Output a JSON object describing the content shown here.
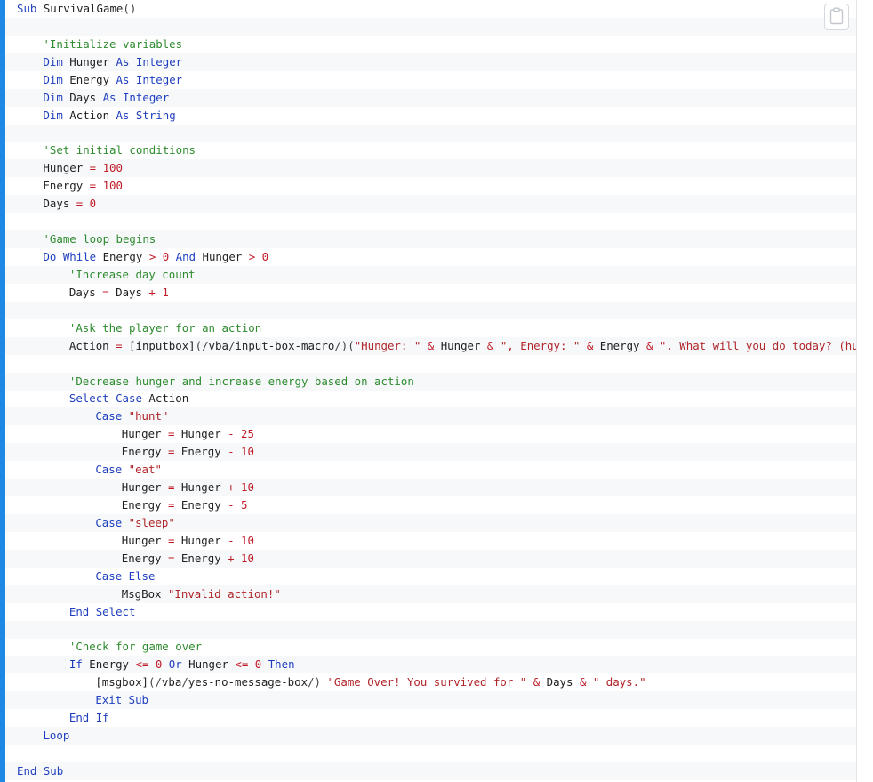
{
  "code_block": {
    "copy_button_label": "Copy",
    "lines": [
      {
        "indent": 0,
        "tokens": [
          {
            "t": "kw",
            "v": "Sub"
          },
          {
            "t": "id",
            "v": " SurvivalGame"
          },
          {
            "t": "punct",
            "v": "()"
          }
        ]
      },
      {
        "indent": 0,
        "tokens": []
      },
      {
        "indent": 4,
        "tokens": [
          {
            "t": "comment",
            "v": "'Initialize variables"
          }
        ]
      },
      {
        "indent": 4,
        "tokens": [
          {
            "t": "kw",
            "v": "Dim"
          },
          {
            "t": "id",
            "v": " Hunger "
          },
          {
            "t": "kw",
            "v": "As"
          },
          {
            "t": "type",
            "v": " Integer"
          }
        ]
      },
      {
        "indent": 4,
        "tokens": [
          {
            "t": "kw",
            "v": "Dim"
          },
          {
            "t": "id",
            "v": " Energy "
          },
          {
            "t": "kw",
            "v": "As"
          },
          {
            "t": "type",
            "v": " Integer"
          }
        ]
      },
      {
        "indent": 4,
        "tokens": [
          {
            "t": "kw",
            "v": "Dim"
          },
          {
            "t": "id",
            "v": " Days "
          },
          {
            "t": "kw",
            "v": "As"
          },
          {
            "t": "type",
            "v": " Integer"
          }
        ]
      },
      {
        "indent": 4,
        "tokens": [
          {
            "t": "kw",
            "v": "Dim"
          },
          {
            "t": "id",
            "v": " Action "
          },
          {
            "t": "kw",
            "v": "As"
          },
          {
            "t": "type",
            "v": " String"
          }
        ]
      },
      {
        "indent": 0,
        "tokens": []
      },
      {
        "indent": 4,
        "tokens": [
          {
            "t": "comment",
            "v": "'Set initial conditions"
          }
        ]
      },
      {
        "indent": 4,
        "tokens": [
          {
            "t": "id",
            "v": "Hunger "
          },
          {
            "t": "op",
            "v": "="
          },
          {
            "t": "num",
            "v": " 100"
          }
        ]
      },
      {
        "indent": 4,
        "tokens": [
          {
            "t": "id",
            "v": "Energy "
          },
          {
            "t": "op",
            "v": "="
          },
          {
            "t": "num",
            "v": " 100"
          }
        ]
      },
      {
        "indent": 4,
        "tokens": [
          {
            "t": "id",
            "v": "Days "
          },
          {
            "t": "op",
            "v": "="
          },
          {
            "t": "num",
            "v": " 0"
          }
        ]
      },
      {
        "indent": 0,
        "tokens": []
      },
      {
        "indent": 4,
        "tokens": [
          {
            "t": "comment",
            "v": "'Game loop begins"
          }
        ]
      },
      {
        "indent": 4,
        "tokens": [
          {
            "t": "kw",
            "v": "Do While"
          },
          {
            "t": "id",
            "v": " Energy "
          },
          {
            "t": "op",
            "v": ">"
          },
          {
            "t": "num",
            "v": " 0"
          },
          {
            "t": "kw",
            "v": " And"
          },
          {
            "t": "id",
            "v": " Hunger "
          },
          {
            "t": "op",
            "v": ">"
          },
          {
            "t": "num",
            "v": " 0"
          }
        ]
      },
      {
        "indent": 8,
        "tokens": [
          {
            "t": "comment",
            "v": "'Increase day count"
          }
        ]
      },
      {
        "indent": 8,
        "tokens": [
          {
            "t": "id",
            "v": "Days "
          },
          {
            "t": "op",
            "v": "="
          },
          {
            "t": "id",
            "v": " Days "
          },
          {
            "t": "op",
            "v": "+"
          },
          {
            "t": "num",
            "v": " 1"
          }
        ]
      },
      {
        "indent": 0,
        "tokens": []
      },
      {
        "indent": 8,
        "tokens": [
          {
            "t": "comment",
            "v": "'Ask the player for an action"
          }
        ]
      },
      {
        "indent": 8,
        "tokens": [
          {
            "t": "id",
            "v": "Action "
          },
          {
            "t": "op",
            "v": "="
          },
          {
            "t": "id",
            "v": " [inputbox]"
          },
          {
            "t": "punct",
            "v": "(/"
          },
          {
            "t": "id",
            "v": "vba"
          },
          {
            "t": "punct",
            "v": "/"
          },
          {
            "t": "id",
            "v": "input-box-macro"
          },
          {
            "t": "punct",
            "v": "/)("
          },
          {
            "t": "str",
            "v": "\"Hunger: \""
          },
          {
            "t": "op",
            "v": " &"
          },
          {
            "t": "id",
            "v": " Hunger "
          },
          {
            "t": "op",
            "v": "&"
          },
          {
            "t": "str",
            "v": " \", Energy: \""
          },
          {
            "t": "op",
            "v": " &"
          },
          {
            "t": "id",
            "v": " Energy "
          },
          {
            "t": "op",
            "v": "&"
          },
          {
            "t": "str",
            "v": " \". What will you do today? (hunt"
          }
        ]
      },
      {
        "indent": 0,
        "tokens": []
      },
      {
        "indent": 8,
        "tokens": [
          {
            "t": "comment",
            "v": "'Decrease hunger and increase energy based on action"
          }
        ]
      },
      {
        "indent": 8,
        "tokens": [
          {
            "t": "kw",
            "v": "Select Case"
          },
          {
            "t": "id",
            "v": " Action"
          }
        ]
      },
      {
        "indent": 12,
        "tokens": [
          {
            "t": "kw",
            "v": "Case"
          },
          {
            "t": "str",
            "v": " \"hunt\""
          }
        ]
      },
      {
        "indent": 16,
        "tokens": [
          {
            "t": "id",
            "v": "Hunger "
          },
          {
            "t": "op",
            "v": "="
          },
          {
            "t": "id",
            "v": " Hunger "
          },
          {
            "t": "op",
            "v": "-"
          },
          {
            "t": "num",
            "v": " 25"
          }
        ]
      },
      {
        "indent": 16,
        "tokens": [
          {
            "t": "id",
            "v": "Energy "
          },
          {
            "t": "op",
            "v": "="
          },
          {
            "t": "id",
            "v": " Energy "
          },
          {
            "t": "op",
            "v": "-"
          },
          {
            "t": "num",
            "v": " 10"
          }
        ]
      },
      {
        "indent": 12,
        "tokens": [
          {
            "t": "kw",
            "v": "Case"
          },
          {
            "t": "str",
            "v": " \"eat\""
          }
        ]
      },
      {
        "indent": 16,
        "tokens": [
          {
            "t": "id",
            "v": "Hunger "
          },
          {
            "t": "op",
            "v": "="
          },
          {
            "t": "id",
            "v": " Hunger "
          },
          {
            "t": "op",
            "v": "+"
          },
          {
            "t": "num",
            "v": " 10"
          }
        ]
      },
      {
        "indent": 16,
        "tokens": [
          {
            "t": "id",
            "v": "Energy "
          },
          {
            "t": "op",
            "v": "="
          },
          {
            "t": "id",
            "v": " Energy "
          },
          {
            "t": "op",
            "v": "-"
          },
          {
            "t": "num",
            "v": " 5"
          }
        ]
      },
      {
        "indent": 12,
        "tokens": [
          {
            "t": "kw",
            "v": "Case"
          },
          {
            "t": "str",
            "v": " \"sleep\""
          }
        ]
      },
      {
        "indent": 16,
        "tokens": [
          {
            "t": "id",
            "v": "Hunger "
          },
          {
            "t": "op",
            "v": "="
          },
          {
            "t": "id",
            "v": " Hunger "
          },
          {
            "t": "op",
            "v": "-"
          },
          {
            "t": "num",
            "v": " 10"
          }
        ]
      },
      {
        "indent": 16,
        "tokens": [
          {
            "t": "id",
            "v": "Energy "
          },
          {
            "t": "op",
            "v": "="
          },
          {
            "t": "id",
            "v": " Energy "
          },
          {
            "t": "op",
            "v": "+"
          },
          {
            "t": "num",
            "v": " 10"
          }
        ]
      },
      {
        "indent": 12,
        "tokens": [
          {
            "t": "kw",
            "v": "Case Else"
          }
        ]
      },
      {
        "indent": 16,
        "tokens": [
          {
            "t": "id",
            "v": "MsgBox "
          },
          {
            "t": "str",
            "v": "\"Invalid action!\""
          }
        ]
      },
      {
        "indent": 8,
        "tokens": [
          {
            "t": "kw",
            "v": "End Select"
          }
        ]
      },
      {
        "indent": 0,
        "tokens": []
      },
      {
        "indent": 8,
        "tokens": [
          {
            "t": "comment",
            "v": "'Check for game over"
          }
        ]
      },
      {
        "indent": 8,
        "tokens": [
          {
            "t": "kw",
            "v": "If"
          },
          {
            "t": "id",
            "v": " Energy "
          },
          {
            "t": "op",
            "v": "<="
          },
          {
            "t": "num",
            "v": " 0"
          },
          {
            "t": "kw",
            "v": " Or"
          },
          {
            "t": "id",
            "v": " Hunger "
          },
          {
            "t": "op",
            "v": "<="
          },
          {
            "t": "num",
            "v": " 0"
          },
          {
            "t": "kw",
            "v": " Then"
          }
        ]
      },
      {
        "indent": 12,
        "tokens": [
          {
            "t": "id",
            "v": "[msgbox]"
          },
          {
            "t": "punct",
            "v": "(/"
          },
          {
            "t": "id",
            "v": "vba"
          },
          {
            "t": "punct",
            "v": "/"
          },
          {
            "t": "id",
            "v": "yes-no-message-box"
          },
          {
            "t": "punct",
            "v": "/) "
          },
          {
            "t": "str",
            "v": "\"Game Over! You survived for \""
          },
          {
            "t": "op",
            "v": " &"
          },
          {
            "t": "id",
            "v": " Days "
          },
          {
            "t": "op",
            "v": "&"
          },
          {
            "t": "str",
            "v": " \" days.\""
          }
        ]
      },
      {
        "indent": 12,
        "tokens": [
          {
            "t": "kw",
            "v": "Exit Sub"
          }
        ]
      },
      {
        "indent": 8,
        "tokens": [
          {
            "t": "kw",
            "v": "End If"
          }
        ]
      },
      {
        "indent": 4,
        "tokens": [
          {
            "t": "kw",
            "v": "Loop"
          }
        ]
      },
      {
        "indent": 0,
        "tokens": []
      },
      {
        "indent": 0,
        "tokens": [
          {
            "t": "kw",
            "v": "End Sub"
          }
        ]
      }
    ]
  }
}
